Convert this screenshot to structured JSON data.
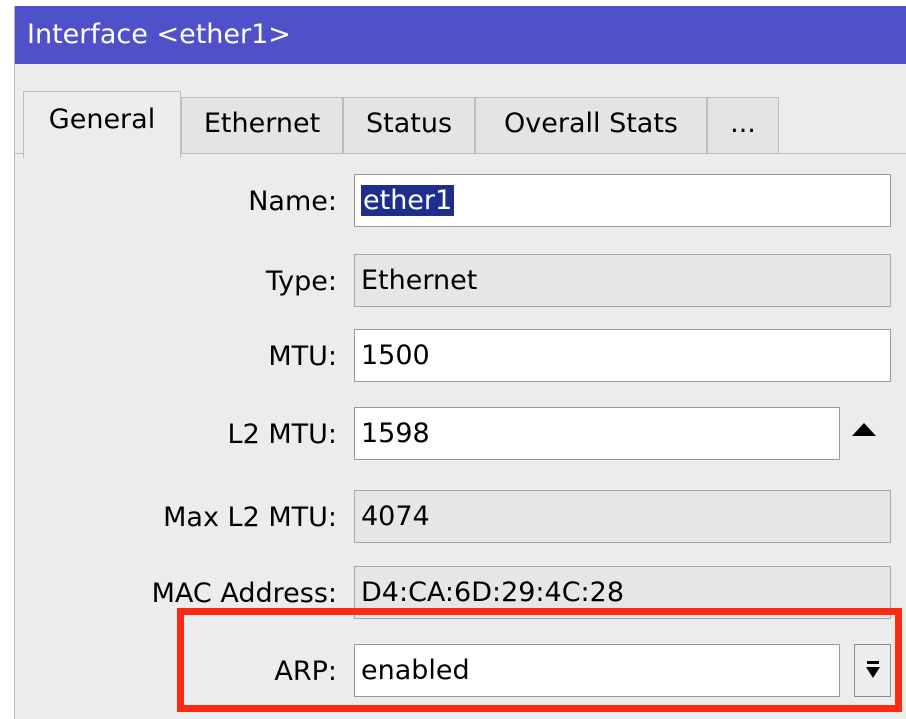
{
  "window": {
    "title": "Interface <ether1>"
  },
  "tabs": [
    {
      "label": "General",
      "active": true
    },
    {
      "label": "Ethernet",
      "active": false
    },
    {
      "label": "Status",
      "active": false
    },
    {
      "label": "Overall Stats",
      "active": false
    },
    {
      "label": "...",
      "active": false
    }
  ],
  "form": {
    "name": {
      "label": "Name:",
      "value": "ether1",
      "selected": true
    },
    "type": {
      "label": "Type:",
      "value": "Ethernet"
    },
    "mtu": {
      "label": "MTU:",
      "value": "1500"
    },
    "l2mtu": {
      "label": "L2 MTU:",
      "value": "1598"
    },
    "max_l2mtu": {
      "label": "Max L2 MTU:",
      "value": "4074"
    },
    "mac": {
      "label": "MAC Address:",
      "value": "D4:CA:6D:29:4C:28"
    },
    "arp": {
      "label": "ARP:",
      "value": "enabled"
    }
  },
  "annotation": {
    "highlight_color": "#ff2a14",
    "highlighted_field": "arp"
  },
  "colors": {
    "titlebar": "#5050c8",
    "selection": "#1e2e8c"
  }
}
